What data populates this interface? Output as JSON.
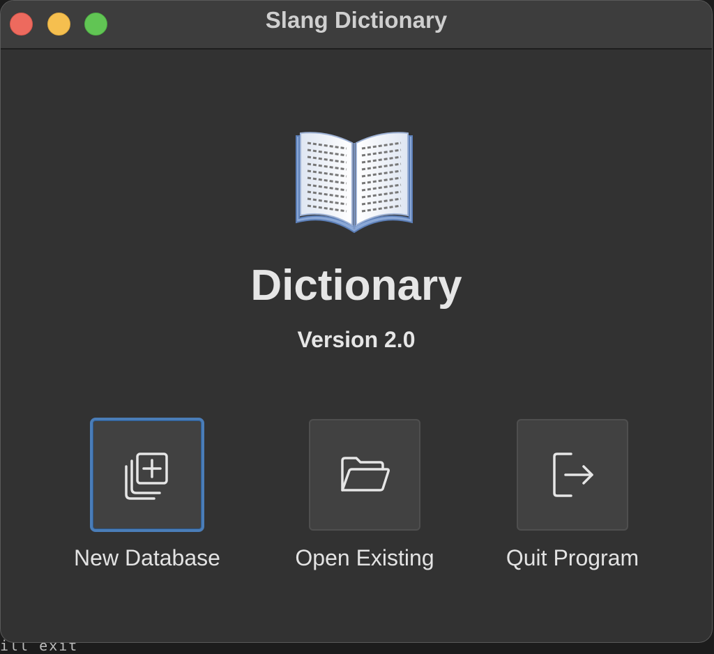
{
  "window": {
    "title": "Slang Dictionary"
  },
  "app": {
    "name": "Dictionary",
    "version": "Version 2.0",
    "icon": "open-book-icon"
  },
  "actions": [
    {
      "label": "New Database",
      "icon": "new-database-icon",
      "selected": true
    },
    {
      "label": "Open Existing",
      "icon": "folder-open-icon",
      "selected": false
    },
    {
      "label": "Quit Program",
      "icon": "exit-icon",
      "selected": false
    }
  ],
  "background_text": "ill exit",
  "colors": {
    "window_bg": "#323232",
    "titlebar_bg": "#3d3d3d",
    "tile_bg": "#414141",
    "selection_border": "#4a7db8",
    "traffic_close": "#ed6a5e",
    "traffic_minimize": "#f5bf4f",
    "traffic_zoom": "#61c554"
  }
}
